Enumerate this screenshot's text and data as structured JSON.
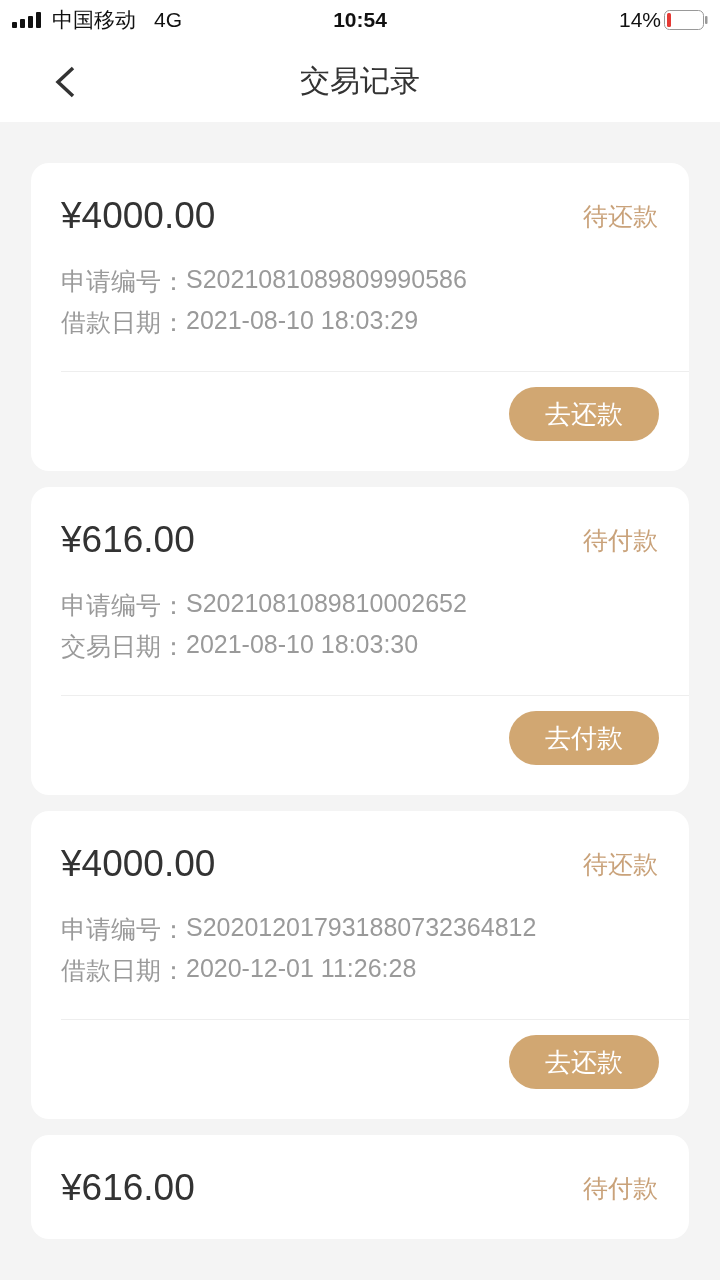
{
  "status_bar": {
    "carrier": "中国移动",
    "network": "4G",
    "time": "10:54",
    "battery": "14%"
  },
  "nav": {
    "title": "交易记录"
  },
  "records": [
    {
      "amount": "¥4000.00",
      "status": "待还款",
      "fields": [
        {
          "label": "申请编号：",
          "value": "S2021081089809990586"
        },
        {
          "label": "借款日期：",
          "value": "2021-08-10 18:03:29"
        }
      ],
      "action": "去还款"
    },
    {
      "amount": "¥616.00",
      "status": "待付款",
      "fields": [
        {
          "label": "申请编号：",
          "value": "S2021081089810002652"
        },
        {
          "label": "交易日期：",
          "value": "2021-08-10 18:03:30"
        }
      ],
      "action": "去付款"
    },
    {
      "amount": "¥4000.00",
      "status": "待还款",
      "fields": [
        {
          "label": "申请编号：",
          "value": "S202012017931880732364812"
        },
        {
          "label": "借款日期：",
          "value": "2020-12-01 11:26:28"
        }
      ],
      "action": "去还款"
    },
    {
      "amount": "¥616.00",
      "status": "待付款"
    }
  ]
}
